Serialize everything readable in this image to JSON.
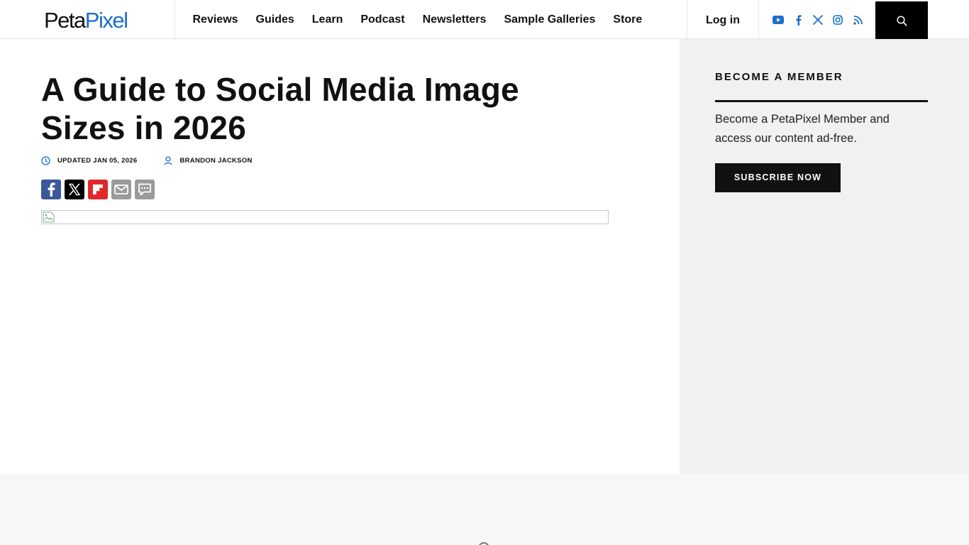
{
  "header": {
    "logo": {
      "part1": "Peta",
      "part2": "Pixel"
    },
    "nav": [
      "Reviews",
      "Guides",
      "Learn",
      "Podcast",
      "Newsletters",
      "Sample Galleries",
      "Store"
    ],
    "login_label": "Log in",
    "social_icons": [
      "youtube-icon",
      "facebook-icon",
      "x-icon",
      "instagram-icon",
      "rss-icon"
    ],
    "search_icon": "search-icon"
  },
  "article": {
    "title": "A Guide to Social Media Image Sizes in 2026",
    "updated": "UPDATED JAN 05, 2026",
    "author": "BRANDON JACKSON",
    "share_icons": [
      "facebook-share-icon",
      "x-share-icon",
      "flipboard-share-icon",
      "email-share-icon",
      "comment-share-icon"
    ]
  },
  "sidebar": {
    "title": "BECOME A MEMBER",
    "text": "Become a PetaPixel Member and access our content ad-free.",
    "button_label": "SUBSCRIBE NOW"
  },
  "colors": {
    "brand_blue": "#1b6fc8",
    "facebook": "#3b5998",
    "flipboard": "#e12828",
    "gray_share": "#9a9a9a",
    "sidebar_bg": "#f1f1f1",
    "dark": "#111111"
  }
}
